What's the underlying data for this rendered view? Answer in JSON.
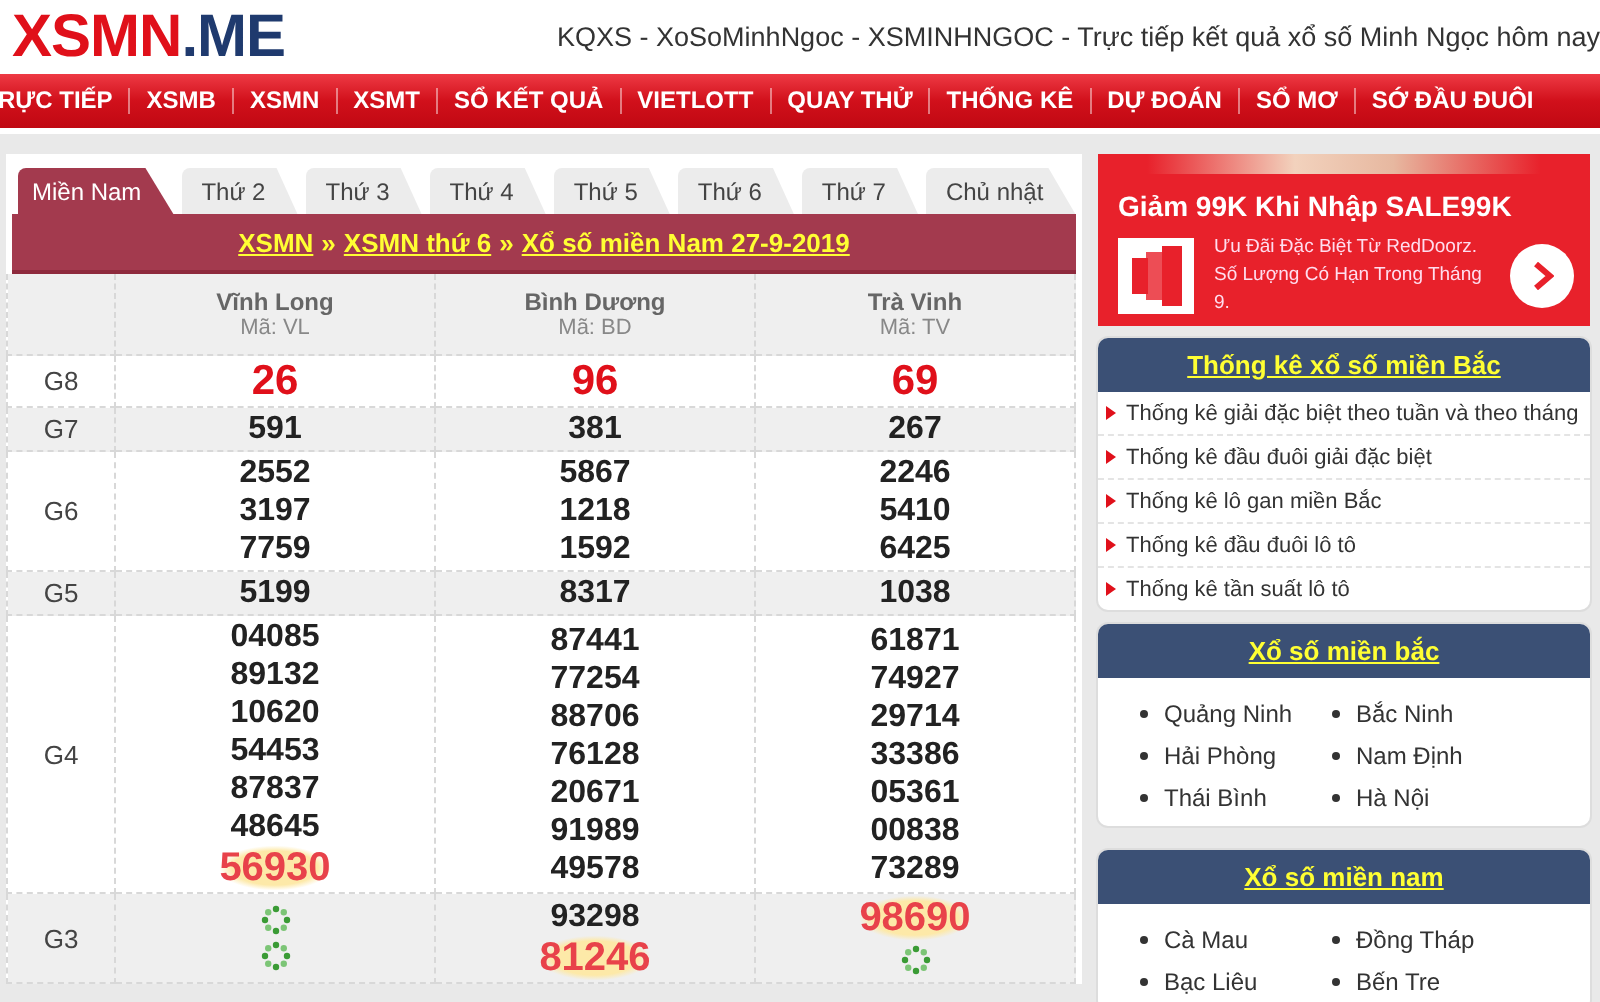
{
  "site": {
    "logo_main": "XSMN",
    "logo_suffix": ".ME",
    "tagline": "KQXS - XoSoMinhNgoc - XSMINHNGOC - Trực tiếp kết quả xổ số Minh Ngọc hôm nay"
  },
  "nav": [
    "RỰC TIẾP",
    "XSMB",
    "XSMN",
    "XSMT",
    "SỔ KẾT QUẢ",
    "VIETLOTT",
    "QUAY THỬ",
    "THỐNG KÊ",
    "DỰ ĐOÁN",
    "SỔ MƠ",
    "SỚ ĐẦU ĐUÔI"
  ],
  "results": {
    "tabs": [
      {
        "label": "Miền Nam",
        "selected": true
      },
      {
        "label": "Thứ 2",
        "selected": false
      },
      {
        "label": "Thứ 3",
        "selected": false
      },
      {
        "label": "Thứ 4",
        "selected": false
      },
      {
        "label": "Thứ 5",
        "selected": false
      },
      {
        "label": "Thứ 6",
        "selected": false
      },
      {
        "label": "Thứ 7",
        "selected": false
      },
      {
        "label": "Chủ nhật",
        "selected": false
      }
    ],
    "breadcrumb": [
      {
        "kind": "link",
        "text": "XSMN"
      },
      {
        "kind": "separator",
        "text": "»"
      },
      {
        "kind": "link",
        "text": "XSMN thứ 6"
      },
      {
        "kind": "separator",
        "text": "»"
      },
      {
        "kind": "link",
        "text": "Xổ số miền Nam 27-9-2019"
      }
    ],
    "provinces": [
      {
        "name": "Vĩnh Long",
        "code": "Mã: VL"
      },
      {
        "name": "Bình Dương",
        "code": "Mã: BD"
      },
      {
        "name": "Trà Vinh",
        "code": "Mã: TV"
      }
    ],
    "rows": [
      {
        "prize": "G8",
        "cells": [
          [
            {
              "kind": "red",
              "text": "26"
            }
          ],
          [
            {
              "kind": "red",
              "text": "96"
            }
          ],
          [
            {
              "kind": "red",
              "text": "69"
            }
          ]
        ]
      },
      {
        "prize": "G7",
        "cells": [
          [
            {
              "kind": "plain",
              "text": "591"
            }
          ],
          [
            {
              "kind": "plain",
              "text": "381"
            }
          ],
          [
            {
              "kind": "plain",
              "text": "267"
            }
          ]
        ]
      },
      {
        "prize": "G6",
        "cells": [
          [
            {
              "kind": "plain",
              "text": "2552"
            },
            {
              "kind": "plain",
              "text": "3197"
            },
            {
              "kind": "plain",
              "text": "7759"
            }
          ],
          [
            {
              "kind": "plain",
              "text": "5867"
            },
            {
              "kind": "plain",
              "text": "1218"
            },
            {
              "kind": "plain",
              "text": "1592"
            }
          ],
          [
            {
              "kind": "plain",
              "text": "2246"
            },
            {
              "kind": "plain",
              "text": "5410"
            },
            {
              "kind": "plain",
              "text": "6425"
            }
          ]
        ]
      },
      {
        "prize": "G5",
        "cells": [
          [
            {
              "kind": "plain",
              "text": "5199"
            }
          ],
          [
            {
              "kind": "plain",
              "text": "8317"
            }
          ],
          [
            {
              "kind": "plain",
              "text": "1038"
            }
          ]
        ]
      },
      {
        "prize": "G4",
        "cells": [
          [
            {
              "kind": "plain",
              "text": "04085"
            },
            {
              "kind": "plain",
              "text": "89132"
            },
            {
              "kind": "plain",
              "text": "10620"
            },
            {
              "kind": "plain",
              "text": "54453"
            },
            {
              "kind": "plain",
              "text": "87837"
            },
            {
              "kind": "plain",
              "text": "48645"
            },
            {
              "kind": "highlight",
              "text": "56930"
            }
          ],
          [
            {
              "kind": "plain",
              "text": "87441"
            },
            {
              "kind": "plain",
              "text": "77254"
            },
            {
              "kind": "plain",
              "text": "88706"
            },
            {
              "kind": "plain",
              "text": "76128"
            },
            {
              "kind": "plain",
              "text": "20671"
            },
            {
              "kind": "plain",
              "text": "91989"
            },
            {
              "kind": "plain",
              "text": "49578"
            }
          ],
          [
            {
              "kind": "plain",
              "text": "61871"
            },
            {
              "kind": "plain",
              "text": "74927"
            },
            {
              "kind": "plain",
              "text": "29714"
            },
            {
              "kind": "plain",
              "text": "33386"
            },
            {
              "kind": "plain",
              "text": "05361"
            },
            {
              "kind": "plain",
              "text": "00838"
            },
            {
              "kind": "plain",
              "text": "73289"
            }
          ]
        ]
      },
      {
        "prize": "G3",
        "cells": [
          [
            {
              "kind": "loading"
            },
            {
              "kind": "loading"
            }
          ],
          [
            {
              "kind": "plain",
              "text": "93298"
            },
            {
              "kind": "highlight",
              "text": "81246"
            }
          ],
          [
            {
              "kind": "highlight",
              "text": "98690"
            },
            {
              "kind": "loading"
            }
          ]
        ]
      }
    ]
  },
  "ad": {
    "title": "Giảm 99K Khi Nhập SALE99K",
    "text": "Ưu Đãi Đặc Biệt Từ RedDoorz. Số Lượng Có Hạn Trong Tháng 9."
  },
  "stats_box": {
    "title": "Thống kê xổ số miền Bắc",
    "items": [
      "Thống kê giải đặc biệt theo tuần và theo tháng",
      "Thống kê đầu đuôi giải đặc biệt",
      "Thống kê lô gan miền Bắc",
      "Thống kê đầu đuôi lô tô",
      "Thống kê tần suất lô tô"
    ]
  },
  "region_boxes": [
    {
      "title": "Xổ số miền bắc",
      "items": [
        "Quảng Ninh",
        "Bắc Ninh",
        "Hải Phòng",
        "Nam Định",
        "Thái Bình",
        "Hà Nội"
      ]
    },
    {
      "title": "Xổ số miền nam",
      "items": [
        "Cà Mau",
        "Đồng Tháp",
        "Bạc Liêu",
        "Bến Tre"
      ]
    }
  ]
}
